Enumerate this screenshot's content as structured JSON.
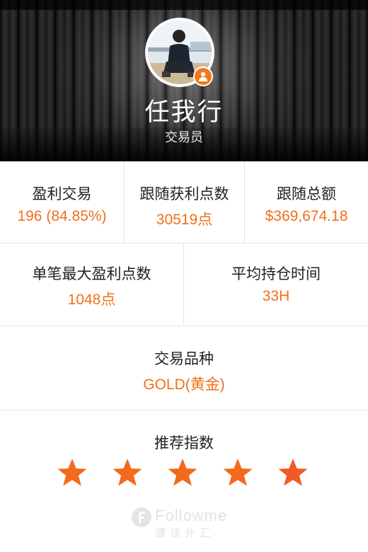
{
  "profile": {
    "name": "任我行",
    "role": "交易员"
  },
  "stats": [
    {
      "label": "盈利交易",
      "value": "196 (84.85%)"
    },
    {
      "label": "跟随获利点数",
      "value": "30519点"
    },
    {
      "label": "跟随总额",
      "value": "$369,674.18"
    },
    {
      "label": "单笔最大盈利点数",
      "value": "1048点"
    },
    {
      "label": "平均持仓时间",
      "value": "33H"
    },
    {
      "label": "交易品种",
      "value": "GOLD(黄金)"
    }
  ],
  "rating": {
    "label": "推荐指数",
    "stars": 5,
    "max": 5
  },
  "watermark": {
    "brand": "Followme",
    "sub": "谭谈外汇"
  },
  "colors": {
    "accent": "#f26f1a",
    "badge": "#f07a1c",
    "star": "#f26a1b",
    "star_last": "#ef5a26"
  }
}
